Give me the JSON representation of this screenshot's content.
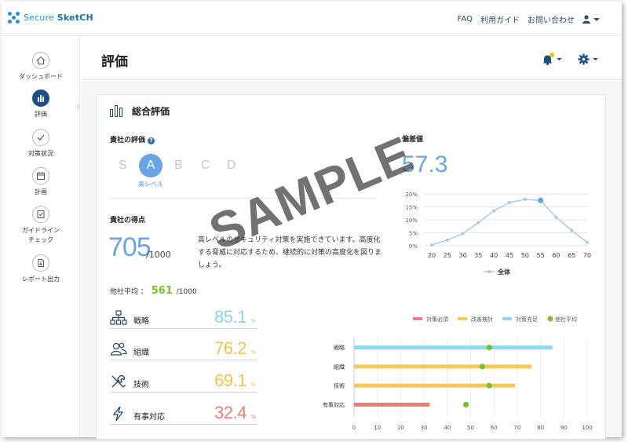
{
  "app": {
    "logo_prefix": "Secure ",
    "logo_bold": "SketCH"
  },
  "topnav": {
    "faq": "FAQ",
    "guide": "利用ガイド",
    "contact": "お問い合わせ"
  },
  "sidebar": {
    "items": [
      {
        "label": "ダッシュボード",
        "icon": "home-icon"
      },
      {
        "label": "評価",
        "icon": "bar-chart-icon",
        "active": true
      },
      {
        "label": "対策状況",
        "icon": "check-icon"
      },
      {
        "label": "計画",
        "icon": "calendar-icon"
      },
      {
        "label": "ガイドライン\nチェック",
        "icon": "document-check-icon"
      },
      {
        "label": "レポート出力",
        "icon": "report-icon"
      }
    ]
  },
  "header": {
    "title": "評価"
  },
  "overall": {
    "title": "総合評価",
    "rating_label": "貴社の評価",
    "help": "?",
    "grades": [
      "S",
      "A",
      "B",
      "C",
      "D"
    ],
    "selected_grade": "A",
    "grade_caption": "高レベル",
    "score_label": "貴社の得点",
    "score": "705",
    "score_denominator": "/1000",
    "description": "高レベルのセキュリティ対策を実施できています。高度化する脅威に対応するため、継続的に対策の高度化を図りましょう。",
    "avg_label": "他社平均 ：",
    "avg_value": "561",
    "avg_denominator": "/1000",
    "deviation_label": "偏差値",
    "deviation_value": "57.3"
  },
  "categories": [
    {
      "name": "戦略",
      "value": "85.1",
      "unit": "%",
      "color": "#8fd9f0",
      "icon": "org-chart-icon"
    },
    {
      "name": "組織",
      "value": "76.2",
      "unit": "%",
      "color": "#f7c85a",
      "icon": "people-icon"
    },
    {
      "name": "技術",
      "value": "69.1",
      "unit": "%",
      "color": "#f7c85a",
      "icon": "tools-icon"
    },
    {
      "name": "有事対応",
      "value": "32.4",
      "unit": "%",
      "color": "#ef7b7b",
      "icon": "lightning-icon"
    }
  ],
  "watermark": "SAMPLE",
  "chart_data": [
    {
      "type": "line",
      "title": "",
      "x": [
        20,
        25,
        30,
        35,
        40,
        45,
        50,
        55,
        60,
        65,
        70
      ],
      "series": [
        {
          "name": "全体",
          "values": [
            0.3,
            2.2,
            4.7,
            8.9,
            13.5,
            16.7,
            17.9,
            17.5,
            11.0,
            5.9,
            1.3
          ]
        }
      ],
      "highlight_x": 55,
      "ylim": [
        0,
        20
      ],
      "yticks": [
        "0%",
        "5%",
        "10%",
        "15%",
        "20%"
      ],
      "xlabel": "",
      "ylabel": "",
      "grid": true,
      "legend": "bottom",
      "color": "#a9c7e8",
      "highlight_color": "#6aa3e6"
    },
    {
      "type": "bar",
      "orientation": "horizontal",
      "categories": [
        "戦略",
        "組織",
        "技術",
        "有事対応"
      ],
      "series": [
        {
          "name": "対策必須",
          "color": "#ef7b7b"
        },
        {
          "name": "改善検討",
          "color": "#f7c85a"
        },
        {
          "name": "対策充足",
          "color": "#8fd9f0"
        },
        {
          "name": "他社平均",
          "color": "#7bbf2e"
        }
      ],
      "values": [
        85.1,
        76.2,
        69.1,
        32.4
      ],
      "bar_series": [
        "対策充足",
        "改善検討",
        "改善検討",
        "対策必須"
      ],
      "averages": [
        58,
        55,
        58,
        48
      ],
      "xlim": [
        0,
        100
      ],
      "xticks": [
        0,
        10,
        20,
        30,
        40,
        50,
        60,
        70,
        80,
        90,
        100
      ],
      "legend": "top-right",
      "grid": true
    }
  ]
}
